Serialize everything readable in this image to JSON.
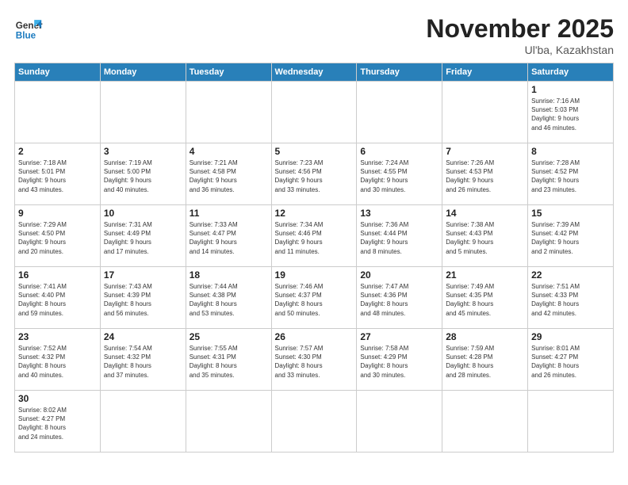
{
  "header": {
    "logo_general": "General",
    "logo_blue": "Blue",
    "title": "November 2025",
    "location": "Ul'ba, Kazakhstan"
  },
  "days_of_week": [
    "Sunday",
    "Monday",
    "Tuesday",
    "Wednesday",
    "Thursday",
    "Friday",
    "Saturday"
  ],
  "weeks": [
    [
      {
        "day": "",
        "info": ""
      },
      {
        "day": "",
        "info": ""
      },
      {
        "day": "",
        "info": ""
      },
      {
        "day": "",
        "info": ""
      },
      {
        "day": "",
        "info": ""
      },
      {
        "day": "",
        "info": ""
      },
      {
        "day": "1",
        "info": "Sunrise: 7:16 AM\nSunset: 5:03 PM\nDaylight: 9 hours\nand 46 minutes."
      }
    ],
    [
      {
        "day": "2",
        "info": "Sunrise: 7:18 AM\nSunset: 5:01 PM\nDaylight: 9 hours\nand 43 minutes."
      },
      {
        "day": "3",
        "info": "Sunrise: 7:19 AM\nSunset: 5:00 PM\nDaylight: 9 hours\nand 40 minutes."
      },
      {
        "day": "4",
        "info": "Sunrise: 7:21 AM\nSunset: 4:58 PM\nDaylight: 9 hours\nand 36 minutes."
      },
      {
        "day": "5",
        "info": "Sunrise: 7:23 AM\nSunset: 4:56 PM\nDaylight: 9 hours\nand 33 minutes."
      },
      {
        "day": "6",
        "info": "Sunrise: 7:24 AM\nSunset: 4:55 PM\nDaylight: 9 hours\nand 30 minutes."
      },
      {
        "day": "7",
        "info": "Sunrise: 7:26 AM\nSunset: 4:53 PM\nDaylight: 9 hours\nand 26 minutes."
      },
      {
        "day": "8",
        "info": "Sunrise: 7:28 AM\nSunset: 4:52 PM\nDaylight: 9 hours\nand 23 minutes."
      }
    ],
    [
      {
        "day": "9",
        "info": "Sunrise: 7:29 AM\nSunset: 4:50 PM\nDaylight: 9 hours\nand 20 minutes."
      },
      {
        "day": "10",
        "info": "Sunrise: 7:31 AM\nSunset: 4:49 PM\nDaylight: 9 hours\nand 17 minutes."
      },
      {
        "day": "11",
        "info": "Sunrise: 7:33 AM\nSunset: 4:47 PM\nDaylight: 9 hours\nand 14 minutes."
      },
      {
        "day": "12",
        "info": "Sunrise: 7:34 AM\nSunset: 4:46 PM\nDaylight: 9 hours\nand 11 minutes."
      },
      {
        "day": "13",
        "info": "Sunrise: 7:36 AM\nSunset: 4:44 PM\nDaylight: 9 hours\nand 8 minutes."
      },
      {
        "day": "14",
        "info": "Sunrise: 7:38 AM\nSunset: 4:43 PM\nDaylight: 9 hours\nand 5 minutes."
      },
      {
        "day": "15",
        "info": "Sunrise: 7:39 AM\nSunset: 4:42 PM\nDaylight: 9 hours\nand 2 minutes."
      }
    ],
    [
      {
        "day": "16",
        "info": "Sunrise: 7:41 AM\nSunset: 4:40 PM\nDaylight: 8 hours\nand 59 minutes."
      },
      {
        "day": "17",
        "info": "Sunrise: 7:43 AM\nSunset: 4:39 PM\nDaylight: 8 hours\nand 56 minutes."
      },
      {
        "day": "18",
        "info": "Sunrise: 7:44 AM\nSunset: 4:38 PM\nDaylight: 8 hours\nand 53 minutes."
      },
      {
        "day": "19",
        "info": "Sunrise: 7:46 AM\nSunset: 4:37 PM\nDaylight: 8 hours\nand 50 minutes."
      },
      {
        "day": "20",
        "info": "Sunrise: 7:47 AM\nSunset: 4:36 PM\nDaylight: 8 hours\nand 48 minutes."
      },
      {
        "day": "21",
        "info": "Sunrise: 7:49 AM\nSunset: 4:35 PM\nDaylight: 8 hours\nand 45 minutes."
      },
      {
        "day": "22",
        "info": "Sunrise: 7:51 AM\nSunset: 4:33 PM\nDaylight: 8 hours\nand 42 minutes."
      }
    ],
    [
      {
        "day": "23",
        "info": "Sunrise: 7:52 AM\nSunset: 4:32 PM\nDaylight: 8 hours\nand 40 minutes."
      },
      {
        "day": "24",
        "info": "Sunrise: 7:54 AM\nSunset: 4:32 PM\nDaylight: 8 hours\nand 37 minutes."
      },
      {
        "day": "25",
        "info": "Sunrise: 7:55 AM\nSunset: 4:31 PM\nDaylight: 8 hours\nand 35 minutes."
      },
      {
        "day": "26",
        "info": "Sunrise: 7:57 AM\nSunset: 4:30 PM\nDaylight: 8 hours\nand 33 minutes."
      },
      {
        "day": "27",
        "info": "Sunrise: 7:58 AM\nSunset: 4:29 PM\nDaylight: 8 hours\nand 30 minutes."
      },
      {
        "day": "28",
        "info": "Sunrise: 7:59 AM\nSunset: 4:28 PM\nDaylight: 8 hours\nand 28 minutes."
      },
      {
        "day": "29",
        "info": "Sunrise: 8:01 AM\nSunset: 4:27 PM\nDaylight: 8 hours\nand 26 minutes."
      }
    ],
    [
      {
        "day": "30",
        "info": "Sunrise: 8:02 AM\nSunset: 4:27 PM\nDaylight: 8 hours\nand 24 minutes."
      },
      {
        "day": "",
        "info": ""
      },
      {
        "day": "",
        "info": ""
      },
      {
        "day": "",
        "info": ""
      },
      {
        "day": "",
        "info": ""
      },
      {
        "day": "",
        "info": ""
      },
      {
        "day": "",
        "info": ""
      }
    ]
  ]
}
